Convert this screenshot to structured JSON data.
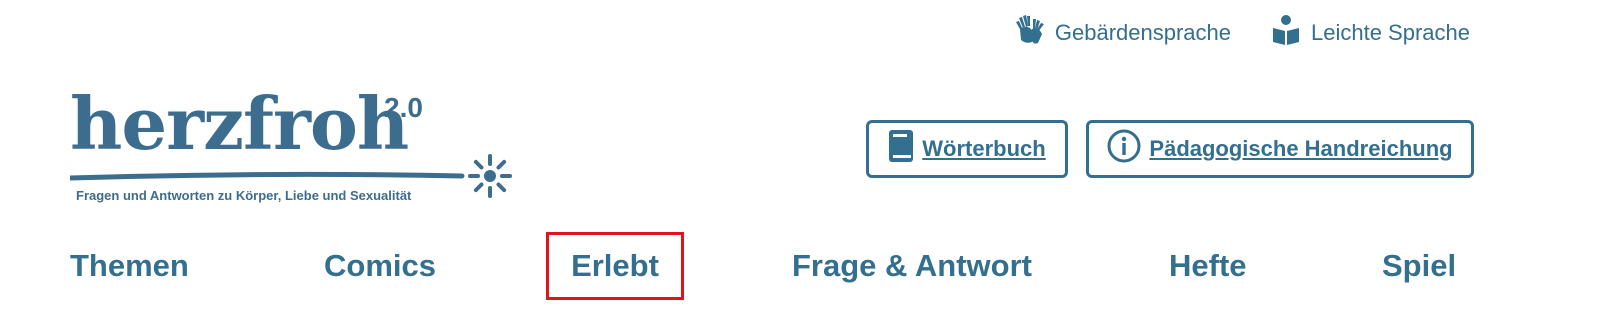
{
  "utility_nav": {
    "sign_language": "Gebärdensprache",
    "easy_language": "Leichte Sprache"
  },
  "logo": {
    "wordmark": "herzfroh",
    "version": "2.0",
    "tagline": "Fragen und Antworten zu Körper, Liebe und Sexualität"
  },
  "actions": {
    "dictionary": "Wörterbuch",
    "guide": "Pädagogische Handreichung"
  },
  "main_nav": {
    "items": [
      {
        "label": "Themen"
      },
      {
        "label": "Comics"
      },
      {
        "label": "Erlebt",
        "highlighted": true
      },
      {
        "label": "Frage & Antwort"
      },
      {
        "label": "Hefte"
      },
      {
        "label": "Spiel"
      }
    ]
  },
  "colors": {
    "primary": "#336f8f",
    "logo": "#3d6d8e",
    "highlight_border": "#e0131e",
    "background": "#ffffff"
  },
  "icons": {
    "sign_language": "hands-icon",
    "easy_language": "reader-icon",
    "dictionary": "book-icon",
    "guide": "info-icon",
    "logo_mark": "sun-flower-icon"
  }
}
